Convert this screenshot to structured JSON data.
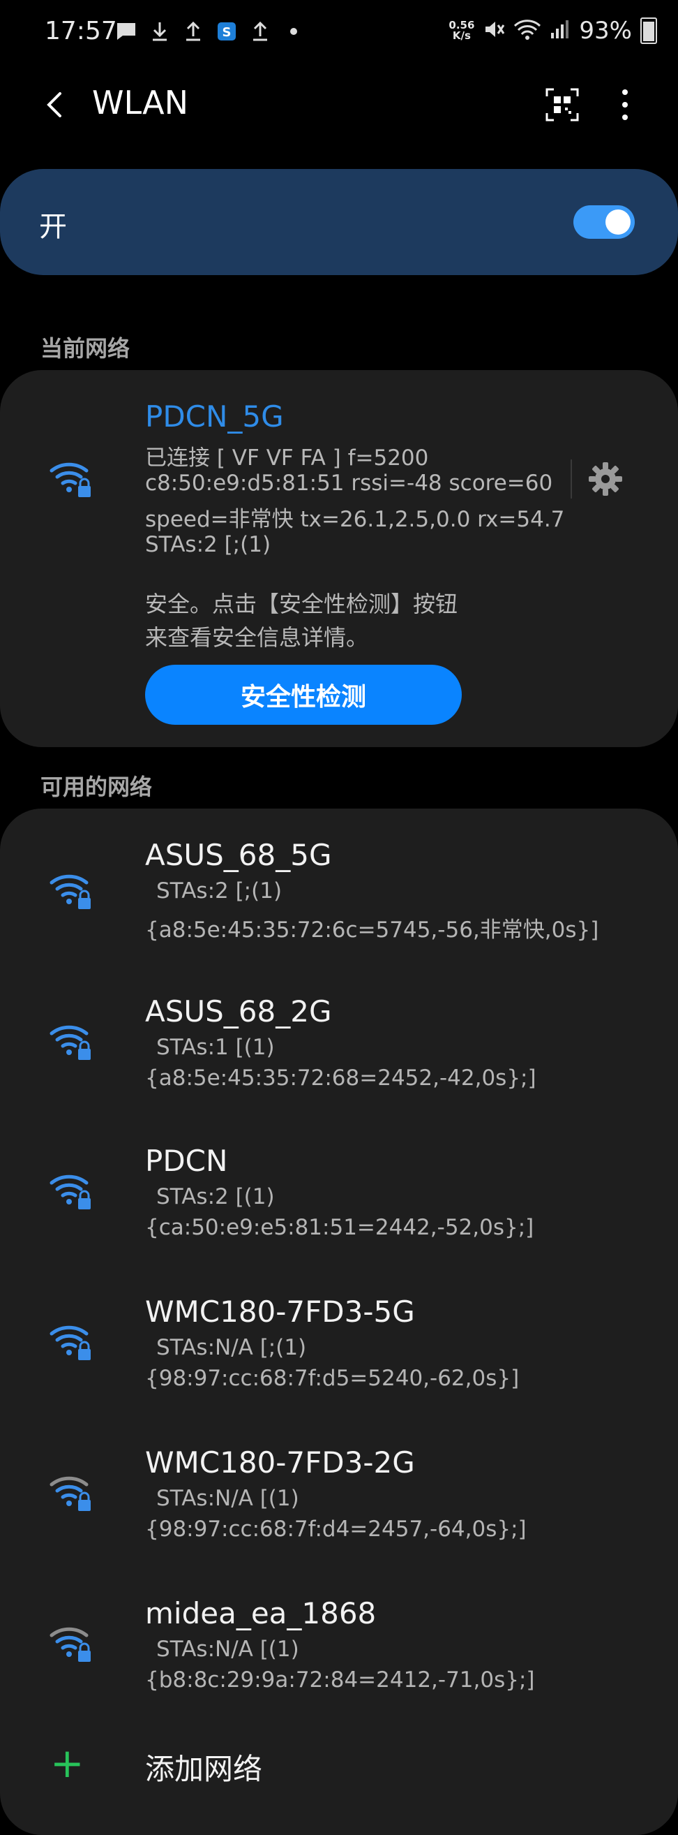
{
  "status_bar": {
    "time": "17:57",
    "net_speed_value": "0.56",
    "net_speed_unit": "K/s",
    "battery": "93%",
    "icons": [
      "message-icon",
      "download-icon",
      "upload-icon",
      "s-app-icon",
      "upload-icon",
      "dot-icon",
      "mute-icon",
      "wifi-icon",
      "signal-icon",
      "battery-icon"
    ]
  },
  "appbar": {
    "title": "WLAN"
  },
  "wlan_toggle": {
    "label": "开",
    "on": true
  },
  "current_section": {
    "title": "当前网络"
  },
  "current_network": {
    "ssid": "PDCN_5G",
    "line1": "已连接 [ VF VF FA ]  f=5200",
    "line2": "c8:50:e9:d5:81:51 rssi=-48  score=60",
    "line3": "speed=非常快 tx=26.1,2.5,0.0 rx=54.7",
    "line4": "STAs:2 [;(1)",
    "security_line1": "安全。点击【安全性检测】按钮",
    "security_line2": "来查看安全信息详情。",
    "security_button": "安全性检测"
  },
  "available_section": {
    "title": "可用的网络"
  },
  "networks": [
    {
      "ssid": "ASUS_68_5G",
      "stas": "STAs:2 [;(1)",
      "detail": "{a8:5e:45:35:72:6c=5745,-56,非常快,0s}]",
      "signal": "strong"
    },
    {
      "ssid": "ASUS_68_2G",
      "stas": "STAs:1 [(1)",
      "detail": "{a8:5e:45:35:72:68=2452,-42,0s};]",
      "signal": "strong"
    },
    {
      "ssid": "PDCN",
      "stas": "STAs:2 [(1)",
      "detail": "{ca:50:e9:e5:81:51=2442,-52,0s};]",
      "signal": "strong"
    },
    {
      "ssid": "WMC180-7FD3-5G",
      "stas": "STAs:N/A [;(1)",
      "detail": "{98:97:cc:68:7f:d5=5240,-62,0s}]",
      "signal": "strong"
    },
    {
      "ssid": "WMC180-7FD3-2G",
      "stas": "STAs:N/A [(1)",
      "detail": "{98:97:cc:68:7f:d4=2457,-64,0s};]",
      "signal": "medium"
    },
    {
      "ssid": "midea_ea_1868",
      "stas": "STAs:N/A [(1)",
      "detail": "{b8:8c:29:9a:72:84=2412,-71,0s};]",
      "signal": "medium"
    }
  ],
  "add_network": {
    "label": "添加网络"
  },
  "colors": {
    "accent": "#2f8ce8",
    "toggle_card": "#1d3a5e",
    "card": "#1e1e1e",
    "button": "#0a84ff",
    "plus": "#28c35a"
  }
}
